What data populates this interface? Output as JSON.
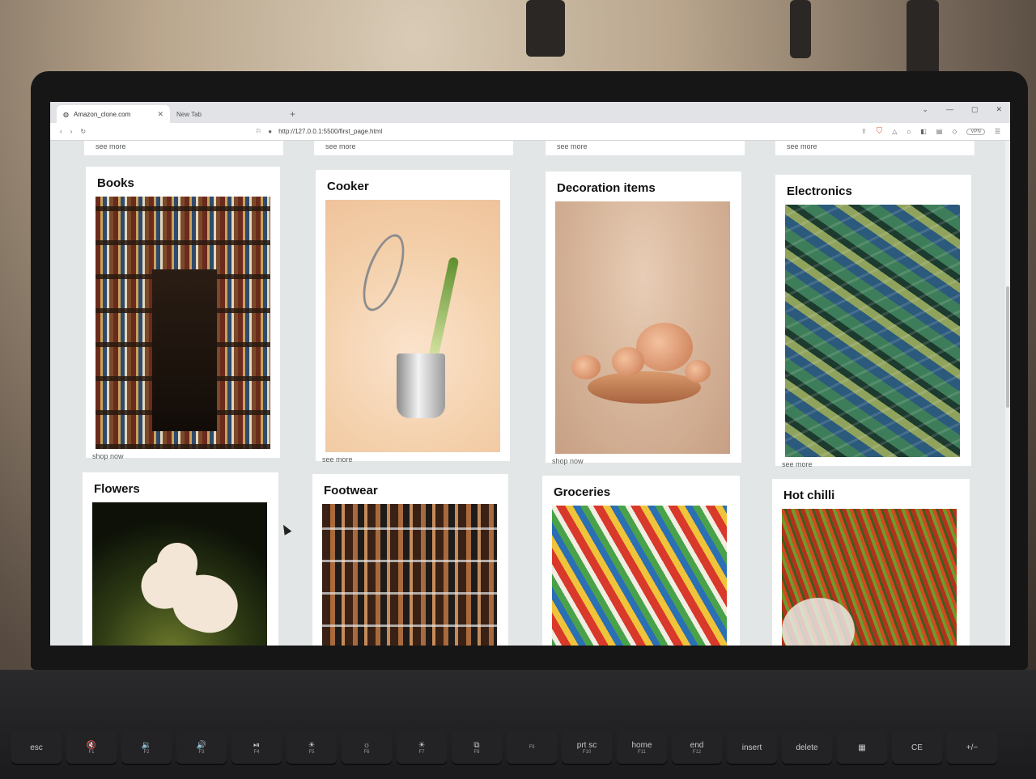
{
  "browser": {
    "tabs": [
      {
        "label": "Amazon_clone.com",
        "active": true
      },
      {
        "label": "New Tab",
        "active": false
      }
    ],
    "new_tab_symbol": "+",
    "url": "http://127.0.0.1:5500/first_page.html",
    "vpn_label": "VPN"
  },
  "page": {
    "previous_row_links": [
      "see more",
      "see more",
      "see more",
      "see more"
    ],
    "cards": [
      {
        "title": "Books",
        "link": "shop now",
        "image": "books-library-photo"
      },
      {
        "title": "Cooker",
        "link": "see more",
        "image": "cooker-pot-photo"
      },
      {
        "title": "Decoration items",
        "link": "shop now",
        "image": "pumpkin-decoration-photo"
      },
      {
        "title": "Electronics",
        "link": "see more",
        "image": "circuit-boards-photo"
      },
      {
        "title": "Flowers",
        "image": "hibiscus-flower-photo"
      },
      {
        "title": "Footwear",
        "image": "sandals-display-photo"
      },
      {
        "title": "Groceries",
        "image": "grocery-shelf-photo"
      },
      {
        "title": "Hot chilli",
        "image": "chilli-market-photo"
      }
    ]
  },
  "keyboard": {
    "keys": [
      {
        "label": "esc",
        "sub": ""
      },
      {
        "label": "🔇",
        "sub": "F1"
      },
      {
        "label": "🔉",
        "sub": "F2"
      },
      {
        "label": "🔊",
        "sub": "F3"
      },
      {
        "label": "⏯",
        "sub": "F4"
      },
      {
        "label": "☀",
        "sub": "F5"
      },
      {
        "label": "☼",
        "sub": "F6"
      },
      {
        "label": "☀",
        "sub": "F7"
      },
      {
        "label": "⧉",
        "sub": "F8"
      },
      {
        "label": "",
        "sub": "F9"
      },
      {
        "label": "prt sc",
        "sub": "F10"
      },
      {
        "label": "home",
        "sub": "F11"
      },
      {
        "label": "end",
        "sub": "F12"
      },
      {
        "label": "insert",
        "sub": ""
      },
      {
        "label": "delete",
        "sub": ""
      },
      {
        "label": "▦",
        "sub": ""
      },
      {
        "label": "CE",
        "sub": ""
      },
      {
        "label": "+/−",
        "sub": ""
      }
    ]
  }
}
